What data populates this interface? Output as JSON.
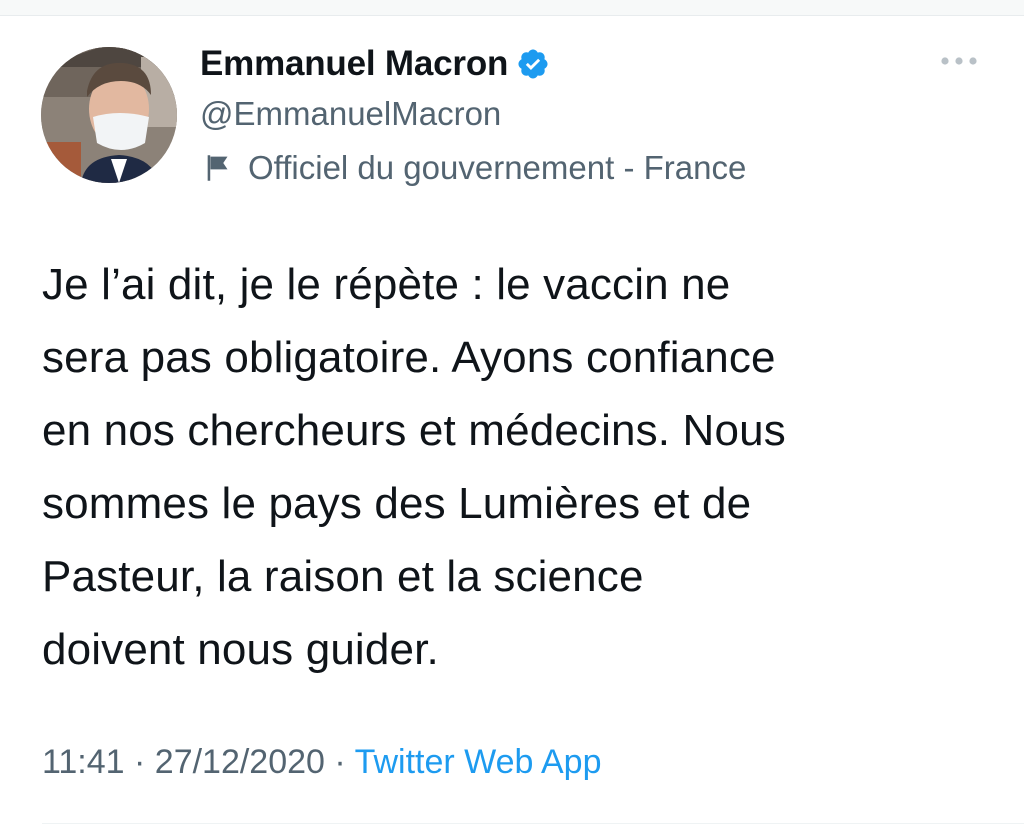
{
  "colors": {
    "text_primary": "#0f1419",
    "text_secondary": "#536471",
    "accent": "#1d9bf0"
  },
  "author": {
    "avatar_icon": "avatar-photo",
    "display_name": "Emmanuel Macron",
    "verified_icon": "verified-badge-icon",
    "handle": "@EmmanuelMacron",
    "label_icon": "flag-icon",
    "label": "Officiel du gouvernement - France"
  },
  "more_icon": "more-options-icon",
  "tweet": {
    "lines": [
      "Je l’ai dit, je le répète : le vaccin ne",
      "sera pas obligatoire. Ayons confiance",
      "en nos chercheurs et médecins. Nous",
      "sommes le pays des Lumières et de",
      "Pasteur, la raison et la science",
      "doivent nous guider."
    ]
  },
  "meta": {
    "time": "11:41",
    "separator": " · ",
    "date": "27/12/2020",
    "source": "Twitter Web App"
  }
}
